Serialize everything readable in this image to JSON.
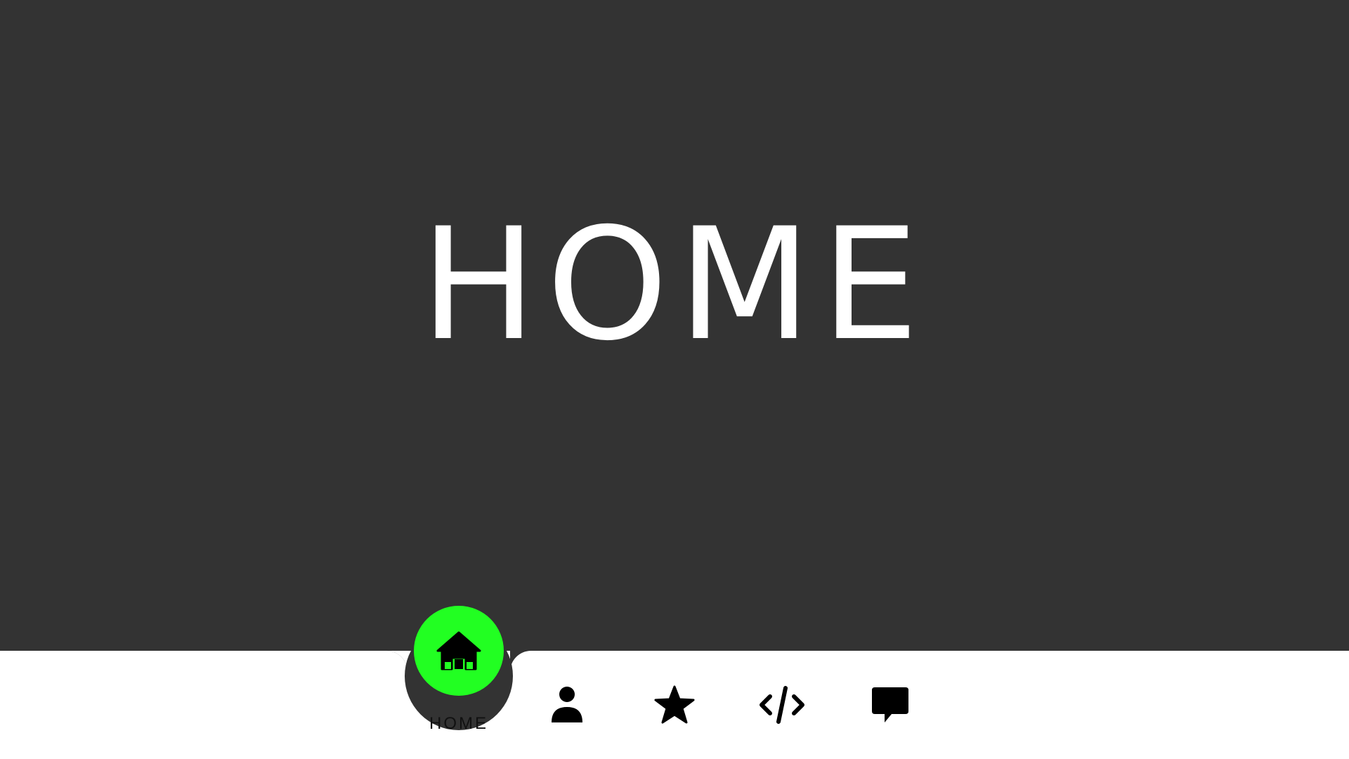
{
  "page": {
    "title": "HOME"
  },
  "nav": {
    "items": [
      {
        "icon": "home-icon",
        "label": "HOME",
        "active": true
      },
      {
        "icon": "user-icon",
        "label": "",
        "active": false
      },
      {
        "icon": "star-icon",
        "label": "",
        "active": false
      },
      {
        "icon": "code-icon",
        "label": "",
        "active": false
      },
      {
        "icon": "chat-icon",
        "label": "",
        "active": false
      }
    ]
  },
  "colors": {
    "background": "#333333",
    "navbar": "#ffffff",
    "active_accent": "#22ff22",
    "icon": "#000000",
    "title_text": "#ffffff"
  }
}
